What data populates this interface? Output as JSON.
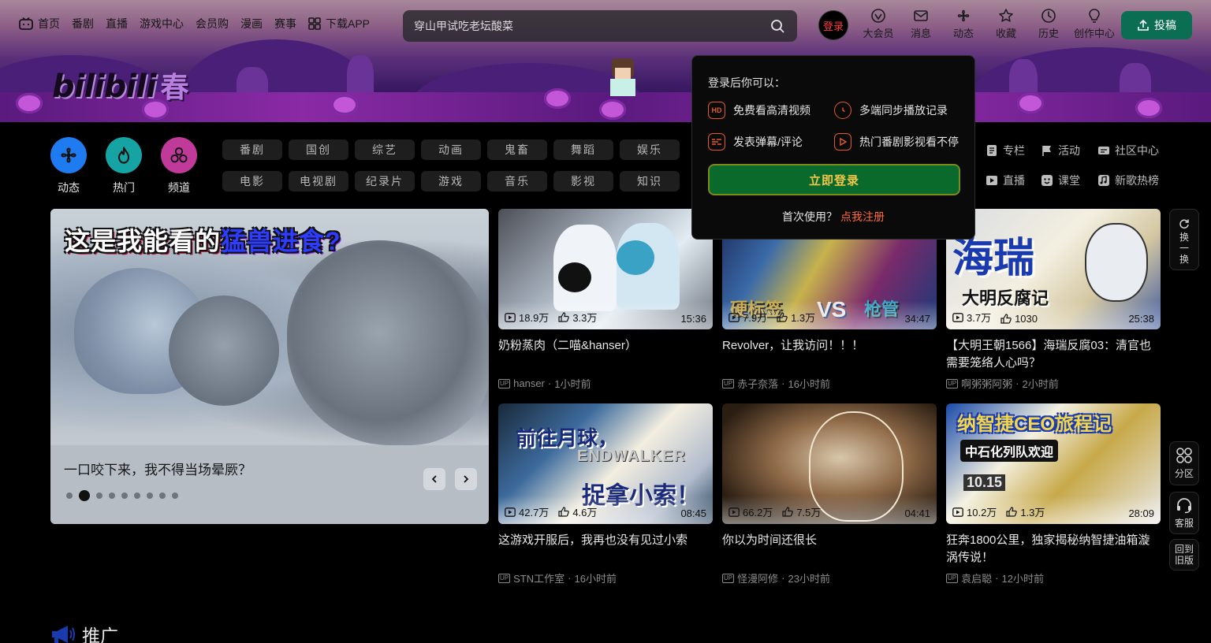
{
  "nav": {
    "left": [
      {
        "label": "首页",
        "icon": "tv-icon"
      },
      {
        "label": "番剧"
      },
      {
        "label": "直播"
      },
      {
        "label": "游戏中心"
      },
      {
        "label": "会员购"
      },
      {
        "label": "漫画"
      },
      {
        "label": "赛事"
      },
      {
        "label": "下载APP",
        "icon": "qr-grid-icon"
      }
    ],
    "search_placeholder": "穿山甲试吃老坛酸菜",
    "login_label": "登录",
    "right": [
      {
        "label": "大会员",
        "icon": "vip-icon"
      },
      {
        "label": "消息",
        "icon": "mail-icon"
      },
      {
        "label": "动态",
        "icon": "wind-icon"
      },
      {
        "label": "收藏",
        "icon": "star-icon"
      },
      {
        "label": "历史",
        "icon": "clock-icon"
      },
      {
        "label": "创作中心",
        "icon": "bulb-icon"
      }
    ],
    "upload_label": "投稿"
  },
  "banner": {
    "logo_text": "bilibili",
    "logo_sub": "春"
  },
  "circles": [
    {
      "label": "动态",
      "color": "#1f7bf0"
    },
    {
      "label": "热门",
      "color": "#16a3a3"
    },
    {
      "label": "频道",
      "color": "#c03a9a"
    }
  ],
  "chips": [
    "番剧",
    "国创",
    "综艺",
    "动画",
    "鬼畜",
    "舞蹈",
    "娱乐",
    "电影",
    "电视剧",
    "纪录片",
    "游戏",
    "音乐",
    "影视",
    "知识"
  ],
  "quicklinks": [
    {
      "label": "专栏"
    },
    {
      "label": "活动"
    },
    {
      "label": "社区中心"
    },
    {
      "label": "直播"
    },
    {
      "label": "课堂"
    },
    {
      "label": "新歌热榜"
    }
  ],
  "carousel": {
    "headline_a": "这是我能看的",
    "headline_b": "猛兽进食?",
    "caption": "一口咬下来，我不得当场晕厥？",
    "dots": 9,
    "active_dot": 2
  },
  "videos": [
    {
      "title": "奶粉蒸肉（二喵&hanser）",
      "views": "18.9万",
      "likes": "3.3万",
      "duration": "15:36",
      "author": "hanser",
      "time": "1小时前"
    },
    {
      "title": "Revolver，让我访问！！！",
      "views": "7.9万",
      "likes": "1.3万",
      "duration": "34:47",
      "author": "赤子奈落",
      "time": "16小时前"
    },
    {
      "title": "【大明王朝1566】海瑞反腐03：清官也需要笼络人心吗？",
      "views": "3.7万",
      "likes": "1030",
      "duration": "25:38",
      "author": "啊粥粥阿粥",
      "time": "2小时前"
    },
    {
      "title": "这游戏开服后，我再也没有见过小索",
      "views": "42.7万",
      "likes": "4.6万",
      "duration": "08:45",
      "author": "STN工作室",
      "time": "16小时前"
    },
    {
      "title": "你以为时间还很长",
      "views": "66.2万",
      "likes": "7.5万",
      "duration": "04:41",
      "author": "怪漫阿修",
      "time": "23小时前"
    },
    {
      "title": "狂奔1800公里，独家揭秘纳智捷油箱漩涡传说！",
      "views": "10.2万",
      "likes": "1.3万",
      "duration": "28:09",
      "author": "袁启聪",
      "time": "12小时前"
    }
  ],
  "sidetools": {
    "refresh": "换一换",
    "partition": "分区",
    "service": "客服",
    "old_version": "回到旧版"
  },
  "promo_label": "推广",
  "popup": {
    "title": "登录后你可以：",
    "benefits": [
      {
        "label": "免费看高清视频",
        "icon": "hd-icon"
      },
      {
        "label": "多端同步播放记录",
        "icon": "sync-clock-icon"
      },
      {
        "label": "发表弹幕/评论",
        "icon": "danmaku-icon"
      },
      {
        "label": "热门番剧影视看不停",
        "icon": "play-icon"
      }
    ],
    "login_button": "立即登录",
    "register_prompt": "首次使用？",
    "register_link": "点我注册"
  },
  "thumb_text": {
    "t2_left": "硬标签",
    "t2_vs": "VS",
    "t2_right": "枪管",
    "t3": "海瑞",
    "t3_sub": "大明反腐记",
    "t4": "前往月球，",
    "t4_sub": "捉拿小索！",
    "t4_en": "ENDWALKER",
    "t6": "纳智捷CEO旅程记",
    "t6_sub": "中石化列队欢迎",
    "t6_price": "10.15"
  }
}
